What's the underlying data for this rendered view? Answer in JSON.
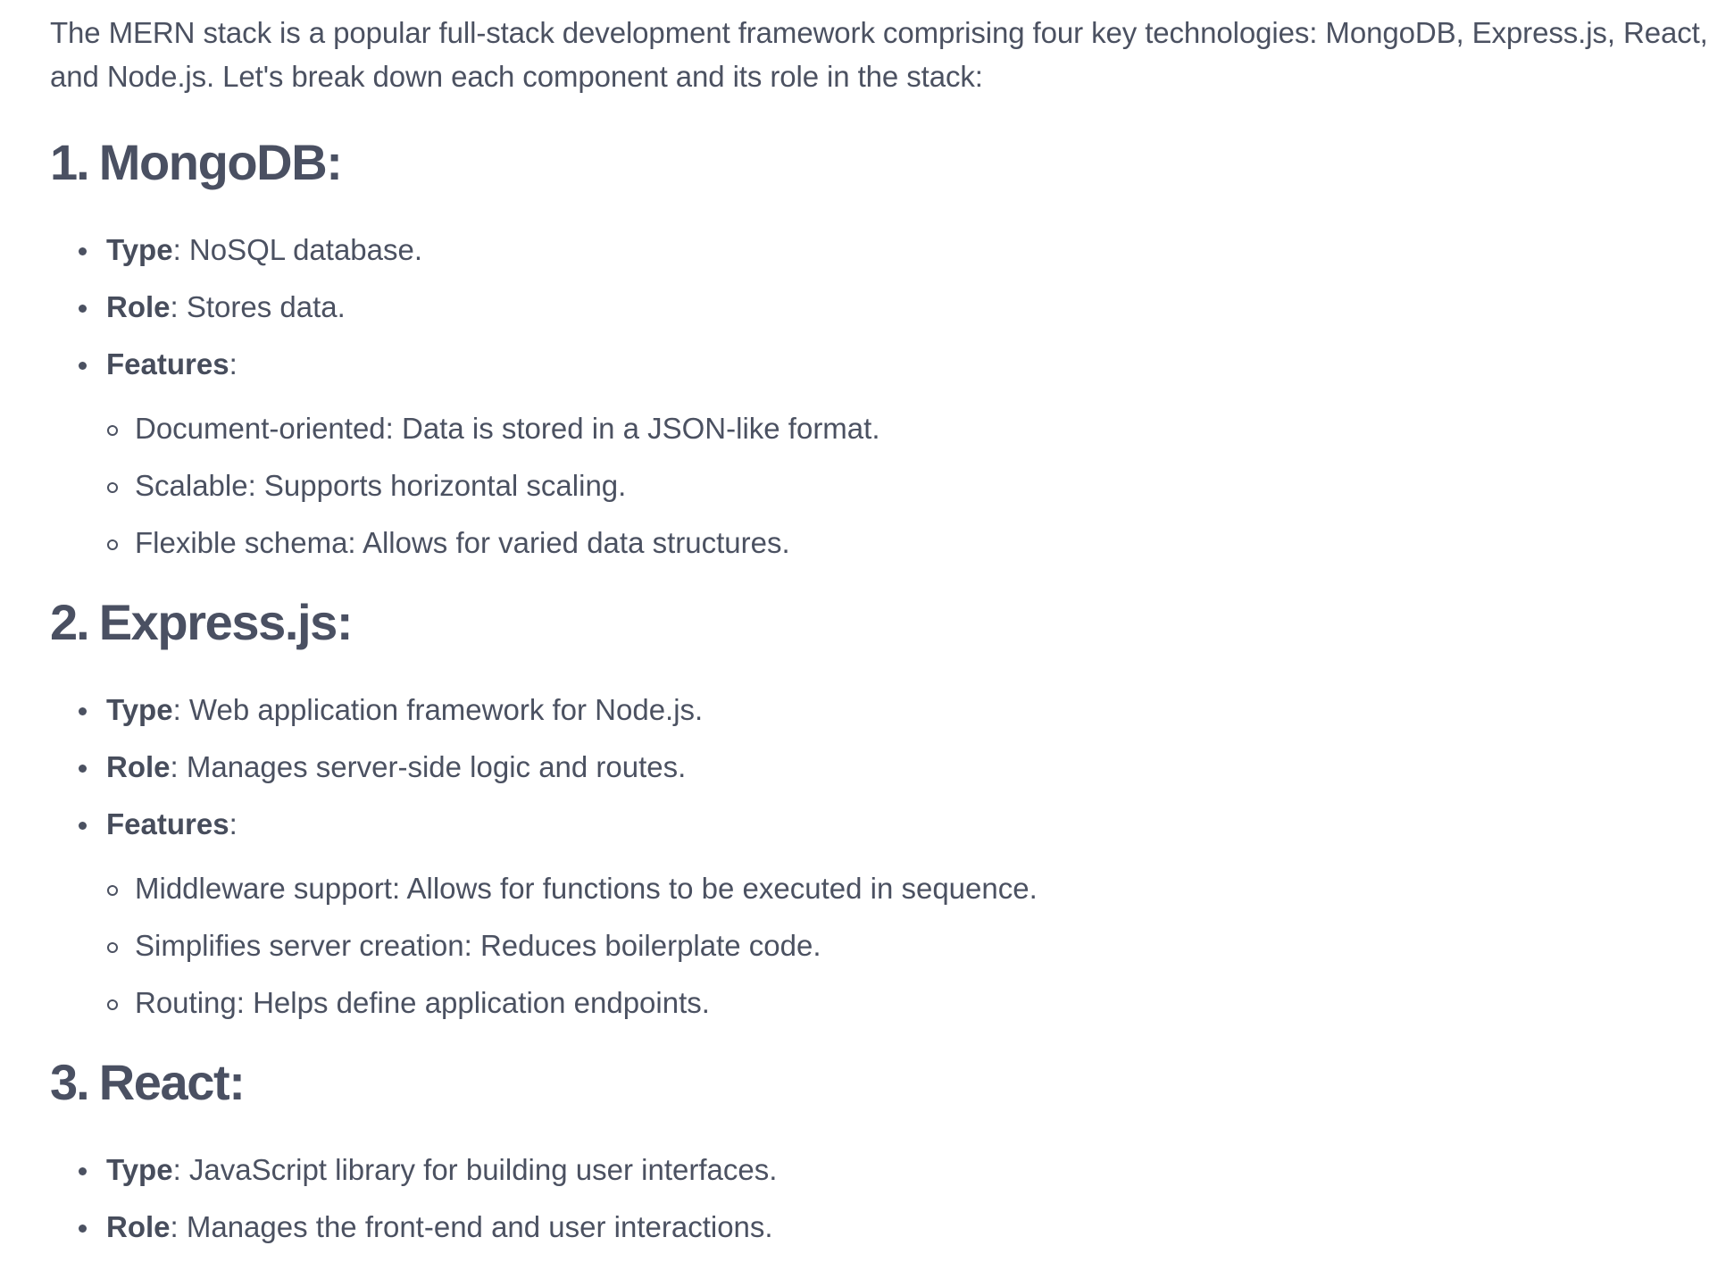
{
  "intro": "The MERN stack is a popular full-stack development framework comprising four key technologies: MongoDB, Express.js, React, and Node.js. Let's break down each component and its role in the stack:",
  "sections": [
    {
      "number": "1.",
      "title": "MongoDB:",
      "items": [
        {
          "key": "Type",
          "text": ": NoSQL database."
        },
        {
          "key": "Role",
          "text": ": Stores data."
        },
        {
          "key": "Features",
          "text": ":"
        }
      ],
      "features": [
        "Document-oriented: Data is stored in a JSON-like format.",
        "Scalable: Supports horizontal scaling.",
        "Flexible schema: Allows for varied data structures."
      ]
    },
    {
      "number": "2.",
      "title": "Express.js:",
      "items": [
        {
          "key": "Type",
          "text": ": Web application framework for Node.js."
        },
        {
          "key": "Role",
          "text": ": Manages server-side logic and routes."
        },
        {
          "key": "Features",
          "text": ":"
        }
      ],
      "features": [
        "Middleware support: Allows for functions to be executed in sequence.",
        "Simplifies server creation: Reduces boilerplate code.",
        "Routing: Helps define application endpoints."
      ]
    },
    {
      "number": "3.",
      "title": "React:",
      "items": [
        {
          "key": "Type",
          "text": ": JavaScript library for building user interfaces."
        },
        {
          "key": "Role",
          "text": ": Manages the front-end and user interactions."
        }
      ]
    }
  ]
}
